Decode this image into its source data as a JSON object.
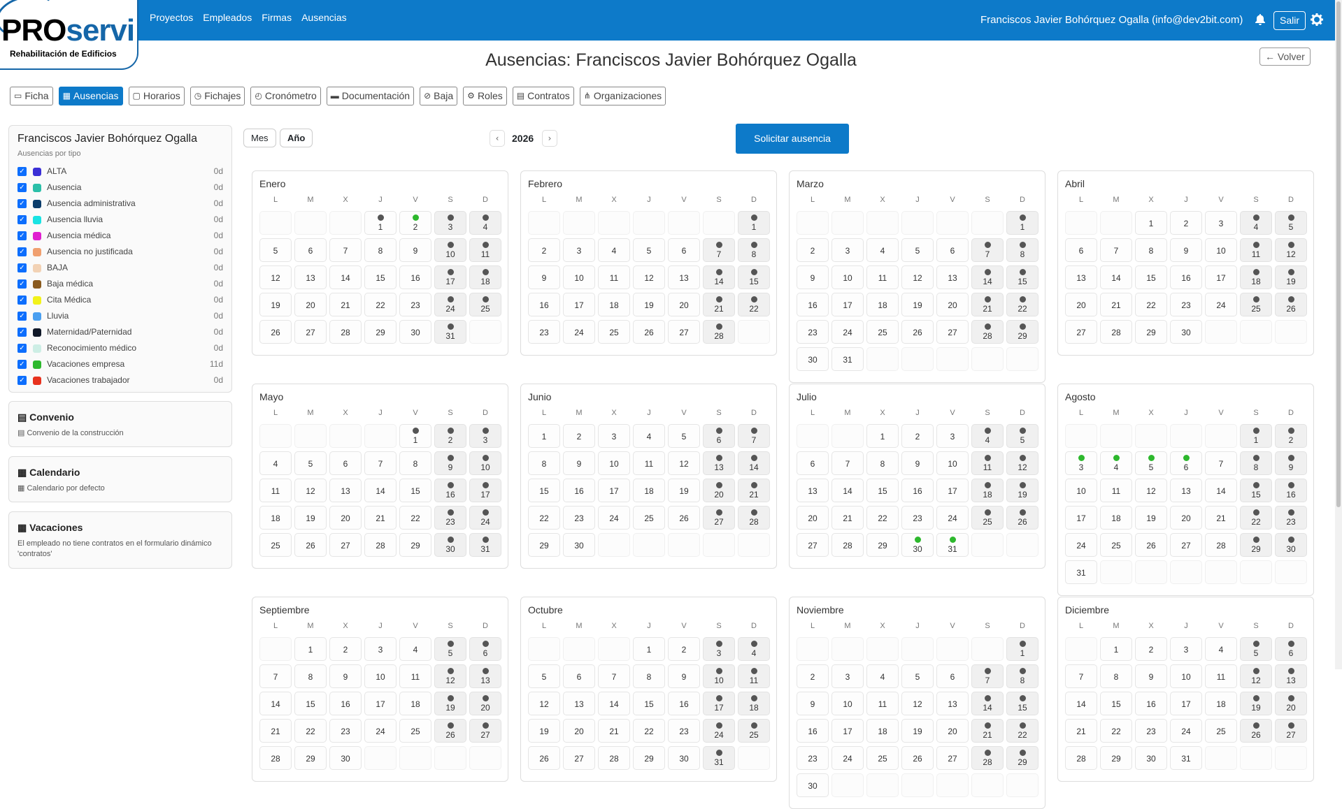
{
  "app": {
    "logo_pro": "PRO",
    "logo_servi": "servi",
    "logo_sub": "Rehabilitación de Edificios",
    "nav": [
      "Proyectos",
      "Empleados",
      "Firmas",
      "Ausencias"
    ],
    "user": "Franciscos Javier Bohórquez Ogalla (info@dev2bit.com)",
    "logout": "Salir"
  },
  "page": {
    "title": "Ausencias: Franciscos Javier Bohórquez Ogalla",
    "back": "Volver"
  },
  "tabs": [
    {
      "label": "Ficha",
      "icon": "id-card-icon",
      "active": false
    },
    {
      "label": "Ausencias",
      "icon": "calendar-icon",
      "active": true
    },
    {
      "label": "Horarios",
      "icon": "calendar-outline-icon",
      "active": false
    },
    {
      "label": "Fichajes",
      "icon": "clock-icon",
      "active": false
    },
    {
      "label": "Cronómetro",
      "icon": "stopwatch-icon",
      "active": false
    },
    {
      "label": "Documentación",
      "icon": "folder-icon",
      "active": false
    },
    {
      "label": "Baja",
      "icon": "user-slash-icon",
      "active": false
    },
    {
      "label": "Roles",
      "icon": "user-gear-icon",
      "active": false
    },
    {
      "label": "Contratos",
      "icon": "file-contract-icon",
      "active": false
    },
    {
      "label": "Organizaciones",
      "icon": "sitemap-icon",
      "active": false
    }
  ],
  "sidebar": {
    "name": "Franciscos Javier Bohórquez Ogalla",
    "subtitle": "Ausencias por tipo",
    "types": [
      {
        "label": "ALTA",
        "color": "#3b2fd6",
        "value": "0d"
      },
      {
        "label": "Ausencia",
        "color": "#2bbfa8",
        "value": "0d"
      },
      {
        "label": "Ausencia administrativa",
        "color": "#0b3d6b",
        "value": "0d"
      },
      {
        "label": "Ausencia lluvia",
        "color": "#19e3e3",
        "value": "0d"
      },
      {
        "label": "Ausencia médica",
        "color": "#e01fd0",
        "value": "0d"
      },
      {
        "label": "Ausencia no justificada",
        "color": "#f0a070",
        "value": "0d"
      },
      {
        "label": "BAJA",
        "color": "#f2d2b5",
        "value": "0d"
      },
      {
        "label": "Baja médica",
        "color": "#8a5a1e",
        "value": "0d"
      },
      {
        "label": "Cita Médica",
        "color": "#f2f21a",
        "value": "0d"
      },
      {
        "label": "Lluvia",
        "color": "#4a9ff0",
        "value": "0d"
      },
      {
        "label": "Maternidad/Paternidad",
        "color": "#101828",
        "value": "0d"
      },
      {
        "label": "Reconocimiento médico",
        "color": "#cdeee5",
        "value": "0d"
      },
      {
        "label": "Vacaciones empresa",
        "color": "#2db82d",
        "value": "11d"
      },
      {
        "label": "Vacaciones trabajador",
        "color": "#e8321e",
        "value": "0d"
      }
    ],
    "convenio": {
      "title": "Convenio",
      "text": "Convenio de la construcción"
    },
    "calendario": {
      "title": "Calendario",
      "text": "Calendario por defecto"
    },
    "vacaciones": {
      "title": "Vacaciones",
      "text": "El empleado no tiene contratos en el formulario dinámico 'contratos'"
    }
  },
  "calendar": {
    "view_month": "Mes",
    "view_year": "Año",
    "year": "2026",
    "prev": "‹",
    "next": "›",
    "request": "Solicitar ausencia",
    "weekdays": [
      "L",
      "M",
      "X",
      "J",
      "V",
      "S",
      "D"
    ],
    "months": [
      {
        "name": "Enero",
        "offset": 3,
        "days": 31,
        "green": [
          2
        ],
        "extra_dots": [
          1
        ]
      },
      {
        "name": "Febrero",
        "offset": 6,
        "days": 28,
        "green": [],
        "extra_dots": []
      },
      {
        "name": "Marzo",
        "offset": 6,
        "days": 31,
        "green": [],
        "extra_dots": []
      },
      {
        "name": "Abril",
        "offset": 2,
        "days": 30,
        "green": [],
        "extra_dots": []
      },
      {
        "name": "Mayo",
        "offset": 4,
        "days": 31,
        "green": [],
        "extra_dots": [
          1
        ]
      },
      {
        "name": "Junio",
        "offset": 0,
        "days": 30,
        "green": [],
        "extra_dots": []
      },
      {
        "name": "Julio",
        "offset": 2,
        "days": 31,
        "green": [
          30,
          31
        ],
        "extra_dots": []
      },
      {
        "name": "Agosto",
        "offset": 5,
        "days": 31,
        "green": [
          3,
          4,
          5,
          6
        ],
        "extra_dots": []
      },
      {
        "name": "Septiembre",
        "offset": 1,
        "days": 30,
        "green": [],
        "extra_dots": []
      },
      {
        "name": "Octubre",
        "offset": 3,
        "days": 31,
        "green": [],
        "extra_dots": []
      },
      {
        "name": "Noviembre",
        "offset": 6,
        "days": 30,
        "green": [],
        "extra_dots": []
      },
      {
        "name": "Diciembre",
        "offset": 1,
        "days": 31,
        "green": [],
        "extra_dots": []
      }
    ]
  }
}
